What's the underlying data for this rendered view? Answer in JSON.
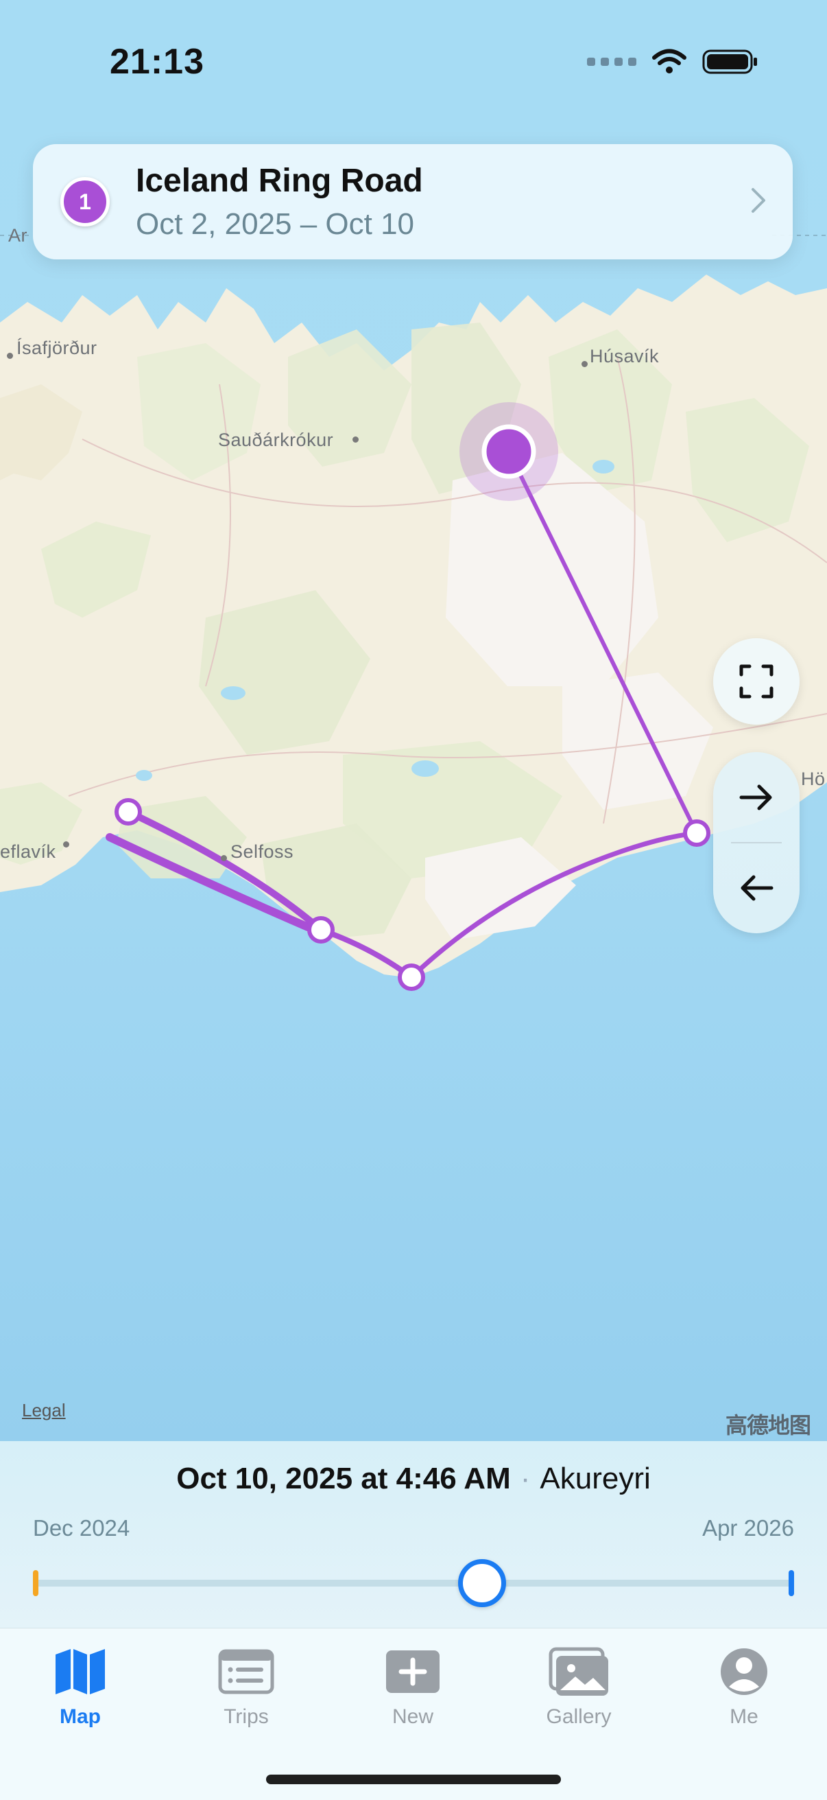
{
  "status_bar": {
    "time": "21:13"
  },
  "trip_card": {
    "badge": "1",
    "title": "Iceland Ring Road",
    "dates": "Oct 2, 2025 – Oct 10"
  },
  "map": {
    "labels": {
      "isafjordur": "Ísafjörður",
      "husavik": "Húsavík",
      "saudarkrokur": "Sauðárkrókur",
      "selfoss": "Selfoss",
      "keflavik": "eflavík",
      "hofn": "Hö",
      "arctic": "Ar"
    },
    "legal": "Legal",
    "watermark": "高德地图",
    "route_color": "#a94fd6"
  },
  "timeline": {
    "current_date": "Oct 10, 2025 at 4:46 AM",
    "current_place": "Akureyri",
    "range_start": "Dec 2024",
    "range_end": "Apr 2026",
    "position_fraction": 0.59
  },
  "tabbar": {
    "map": "Map",
    "trips": "Trips",
    "new": "New",
    "gallery": "Gallery",
    "me": "Me",
    "active_color": "#1b7cf2",
    "inactive_color": "#9aa0a6"
  }
}
